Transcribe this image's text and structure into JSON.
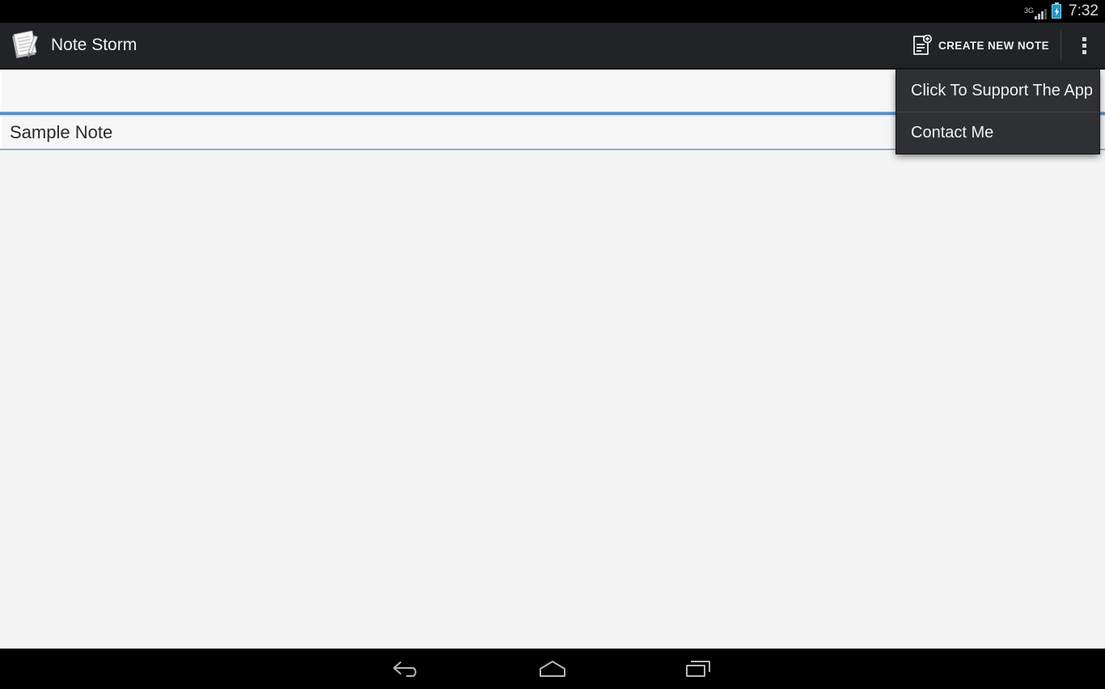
{
  "status_bar": {
    "network_type": "3G",
    "battery_icon": "battery-charging-icon",
    "signal_icon": "signal-bars-icon",
    "time": "7:32"
  },
  "action_bar": {
    "logo_icon": "notepad-pencil-logo-icon",
    "title": "Note Storm",
    "create_note": {
      "icon": "note-add-icon",
      "label": "CREATE NEW NOTE"
    },
    "overflow_icon": "overflow-menu-dots-icon"
  },
  "overflow_menu": {
    "open": true,
    "items": [
      {
        "label": "Click To Support The App"
      },
      {
        "label": "Contact Me"
      }
    ]
  },
  "note_list": {
    "rows": [
      {
        "title": ""
      },
      {
        "title": "Sample Note"
      }
    ]
  },
  "nav_bar": {
    "back_icon": "back-arrow-icon",
    "home_icon": "home-icon",
    "recents_icon": "recent-apps-icon"
  },
  "colors": {
    "status_bar_bg": "#000000",
    "action_bar_bg": "#222326",
    "content_bg": "#f4f4f4",
    "dropdown_bg": "#2e3033",
    "accent_blue": "#5b8dc4",
    "battery_blue": "#2196c9",
    "nav_bar_bg": "#000000"
  }
}
